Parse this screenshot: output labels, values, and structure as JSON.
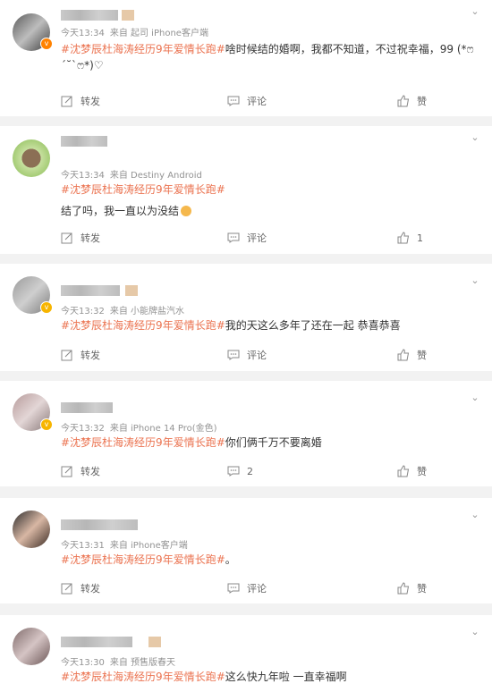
{
  "actions": {
    "repost": "转发",
    "comment": "评论",
    "like": "赞"
  },
  "comments": [
    {
      "time": "今天13:34",
      "source": "来自 起司 iPhone客户端",
      "topic": "#沈梦辰杜海涛经历9年爱情长跑#",
      "text": "啥时候结的婚啊，我都不知道，不过祝幸福，99 (*ෆ´˘`ෆ*)♡",
      "comment_count": "",
      "like_count": ""
    },
    {
      "time": "今天13:34",
      "source": "来自 Destiny Android",
      "topic": "#沈梦辰杜海涛经历9年爱情长跑#",
      "text": "结了吗，我一直以为没结",
      "comment_count": "",
      "like_count": "1"
    },
    {
      "time": "今天13:32",
      "source": "来自 小能牌盐汽水",
      "topic": "#沈梦辰杜海涛经历9年爱情长跑#",
      "text": "我的天这么多年了还在一起 恭喜恭喜",
      "comment_count": "",
      "like_count": ""
    },
    {
      "time": "今天13:32",
      "source": "来自 iPhone 14 Pro(金色)",
      "topic": "#沈梦辰杜海涛经历9年爱情长跑#",
      "text": "你们俩千万不要离婚",
      "comment_count": "2",
      "like_count": ""
    },
    {
      "time": "今天13:31",
      "source": "来自 iPhone客户端",
      "topic": "#沈梦辰杜海涛经历9年爱情长跑#",
      "text": "。",
      "comment_count": "",
      "like_count": ""
    },
    {
      "time": "今天13:30",
      "source": "来自 预售版春天",
      "topic": "#沈梦辰杜海涛经历9年爱情长跑#",
      "text": "这么快九年啦 一直幸福啊",
      "comment_count": "",
      "like_count": ""
    }
  ]
}
